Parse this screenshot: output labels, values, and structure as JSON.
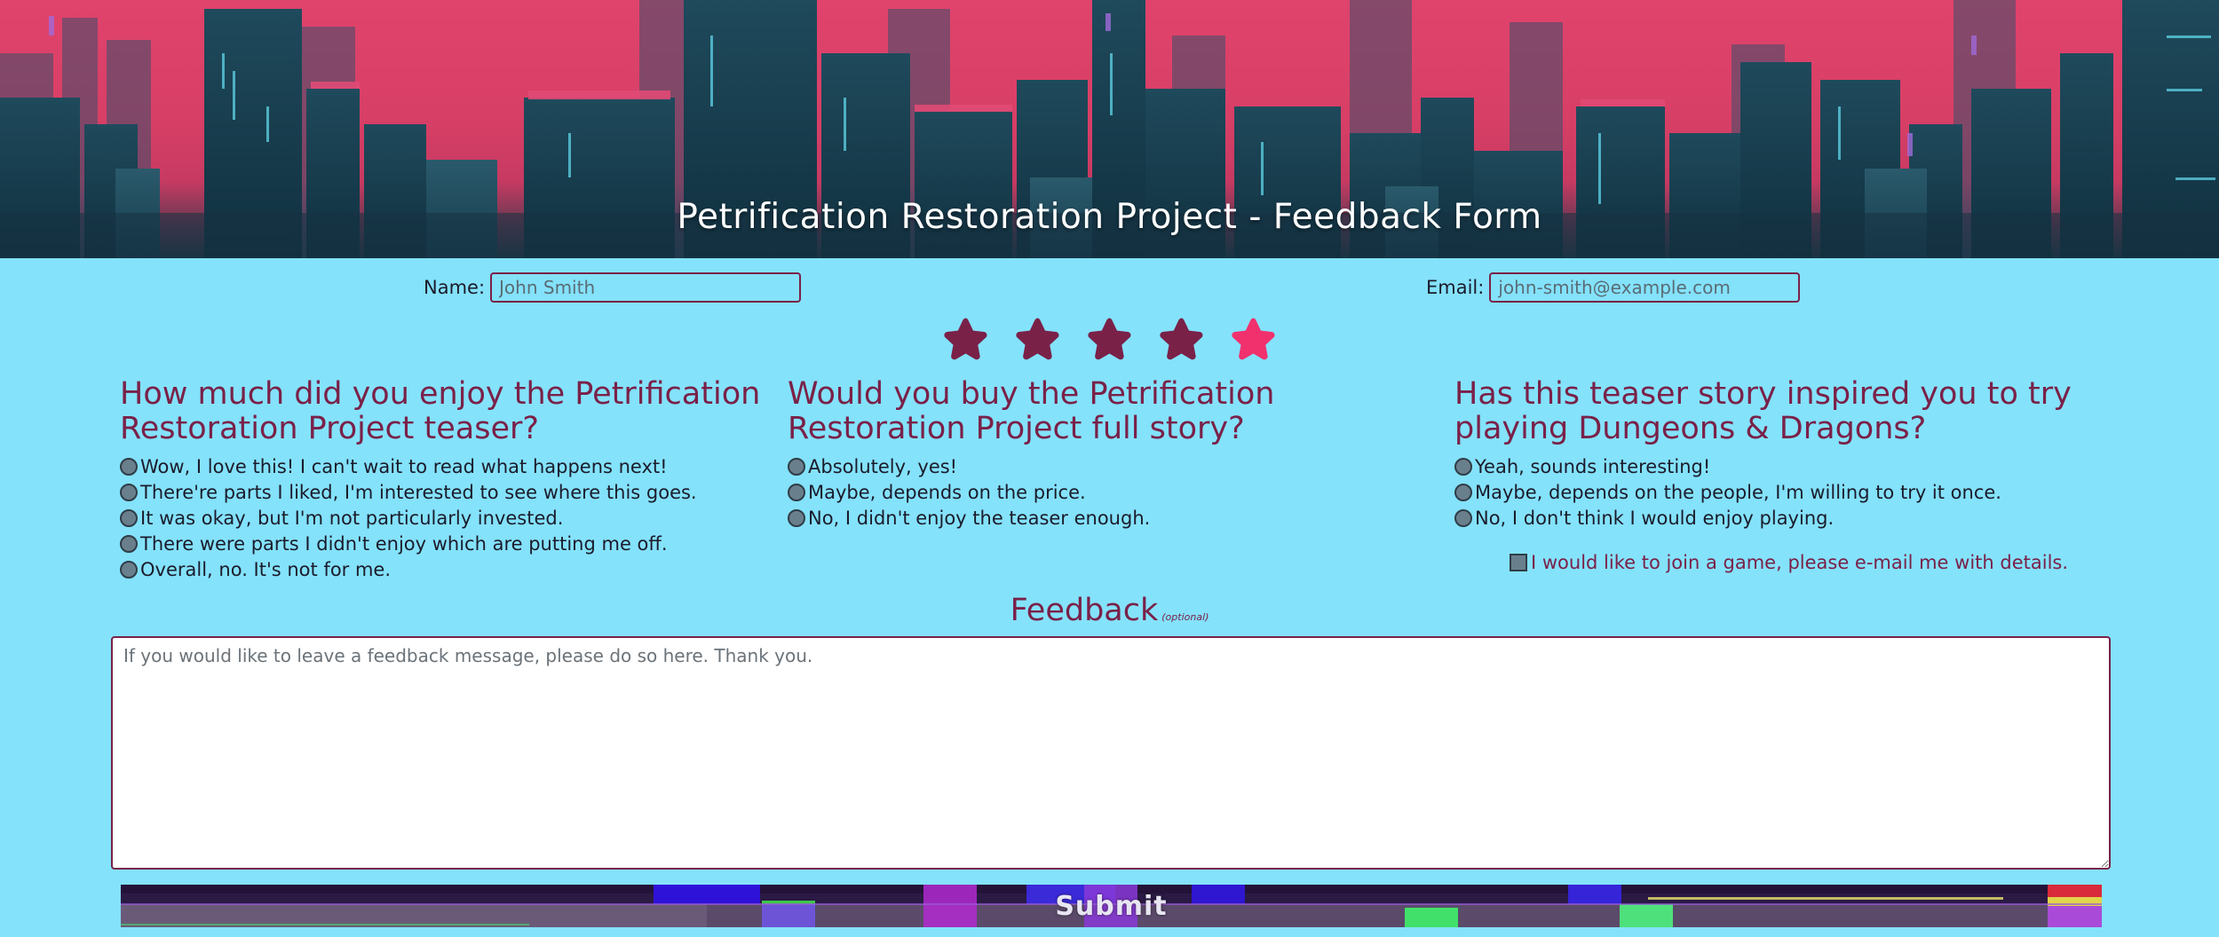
{
  "header": {
    "title": "Petrification Restoration Project - Feedback Form"
  },
  "form": {
    "name_label": "Name:",
    "name_placeholder": "John Smith",
    "email_label": "Email:",
    "email_placeholder": "john-smith@example.com"
  },
  "rating": {
    "max": 5,
    "selected": 5,
    "hover_color": "#f0316d",
    "default_color": "#7a2148"
  },
  "questions": [
    {
      "title": "How much did you enjoy the Petrification Restoration Project teaser?",
      "options": [
        "Wow, I love this! I can't wait to read what happens next!",
        "There're parts I liked, I'm interested to see where this goes.",
        "It was okay, but I'm not particularly invested.",
        "There were parts I didn't enjoy which are putting me off.",
        "Overall, no. It's not for me."
      ]
    },
    {
      "title": "Would you buy the Petrification Restoration Project full story?",
      "options": [
        "Absolutely, yes!",
        "Maybe, depends on the price.",
        "No, I didn't enjoy the teaser enough."
      ]
    },
    {
      "title": "Has this teaser story inspired you to try playing Dungeons & Dragons?",
      "options": [
        "Yeah, sounds interesting!",
        "Maybe, depends on the people, I'm willing to try it once.",
        "No, I don't think I would enjoy playing."
      ]
    }
  ],
  "join": {
    "label": "I would like to join a game, please e-mail me with details."
  },
  "feedback": {
    "heading": "Feedback",
    "optional_note": "(optional)",
    "placeholder": "If you would like to leave a feedback message, please do so here. Thank you."
  },
  "submit": {
    "label": "Submit"
  },
  "colors": {
    "page_background": "#84e2fb",
    "accent": "#7a2148",
    "banner_pink": "#d83f66",
    "banner_teal": "#1d3847"
  }
}
